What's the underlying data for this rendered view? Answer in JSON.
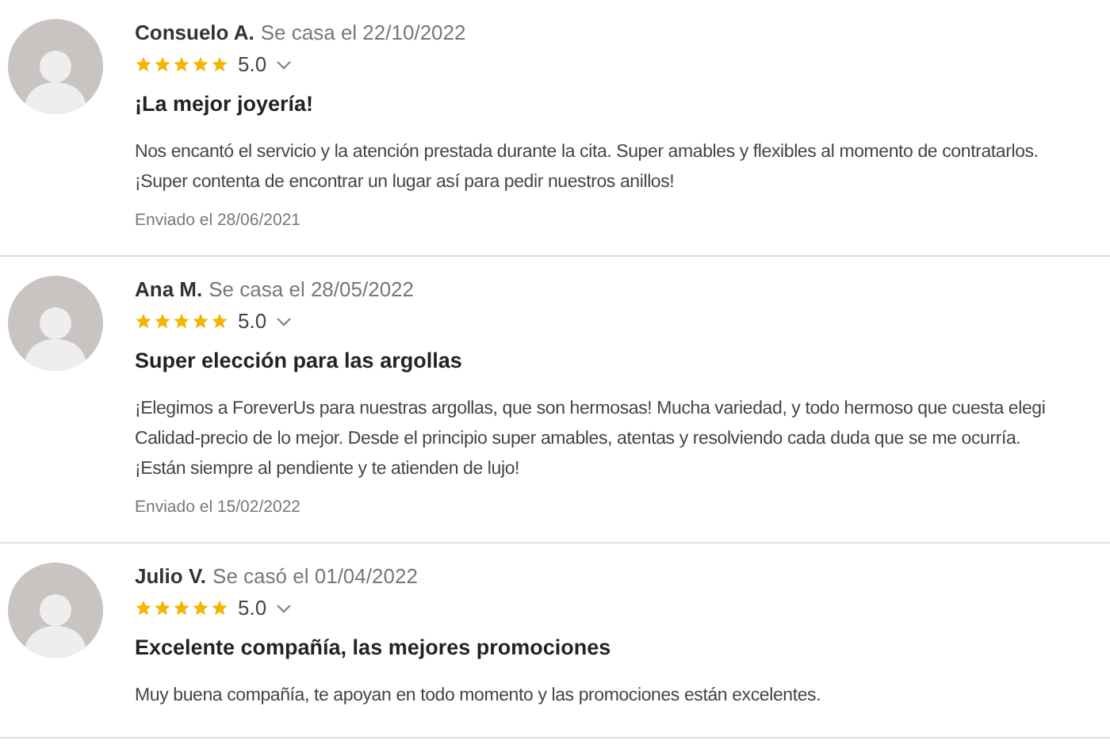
{
  "reviews": [
    {
      "name": "Consuelo A.",
      "wedding": "Se casa el 22/10/2022",
      "stars": 5,
      "rating": "5.0",
      "title": "¡La mejor joyería!",
      "body": [
        "Nos encantó el servicio y la atención prestada durante la cita. Super amables y flexibles al momento de contratarlos.",
        "¡Super contenta de encontrar un lugar así para pedir nuestros anillos!"
      ],
      "sent": "Enviado el 28/06/2021"
    },
    {
      "name": "Ana M.",
      "wedding": "Se casa el 28/05/2022",
      "stars": 5,
      "rating": "5.0",
      "title": "Super elección para las argollas",
      "body": [
        "¡Elegimos a ForeverUs para nuestras argollas, que son hermosas! Mucha variedad, y todo hermoso que cuesta elegi",
        "Calidad-precio de lo mejor. Desde el principio super amables, atentas y resolviendo cada duda que se me ocurría.",
        "¡Están siempre al pendiente y te atienden de lujo!"
      ],
      "sent": "Enviado el 15/02/2022"
    },
    {
      "name": "Julio V.",
      "wedding": "Se casó el 01/04/2022",
      "stars": 5,
      "rating": "5.0",
      "title": "Excelente compañía, las mejores promociones",
      "body": [
        "Muy buena compañía, te apoyan en todo momento y las promociones están excelentes."
      ]
    }
  ]
}
